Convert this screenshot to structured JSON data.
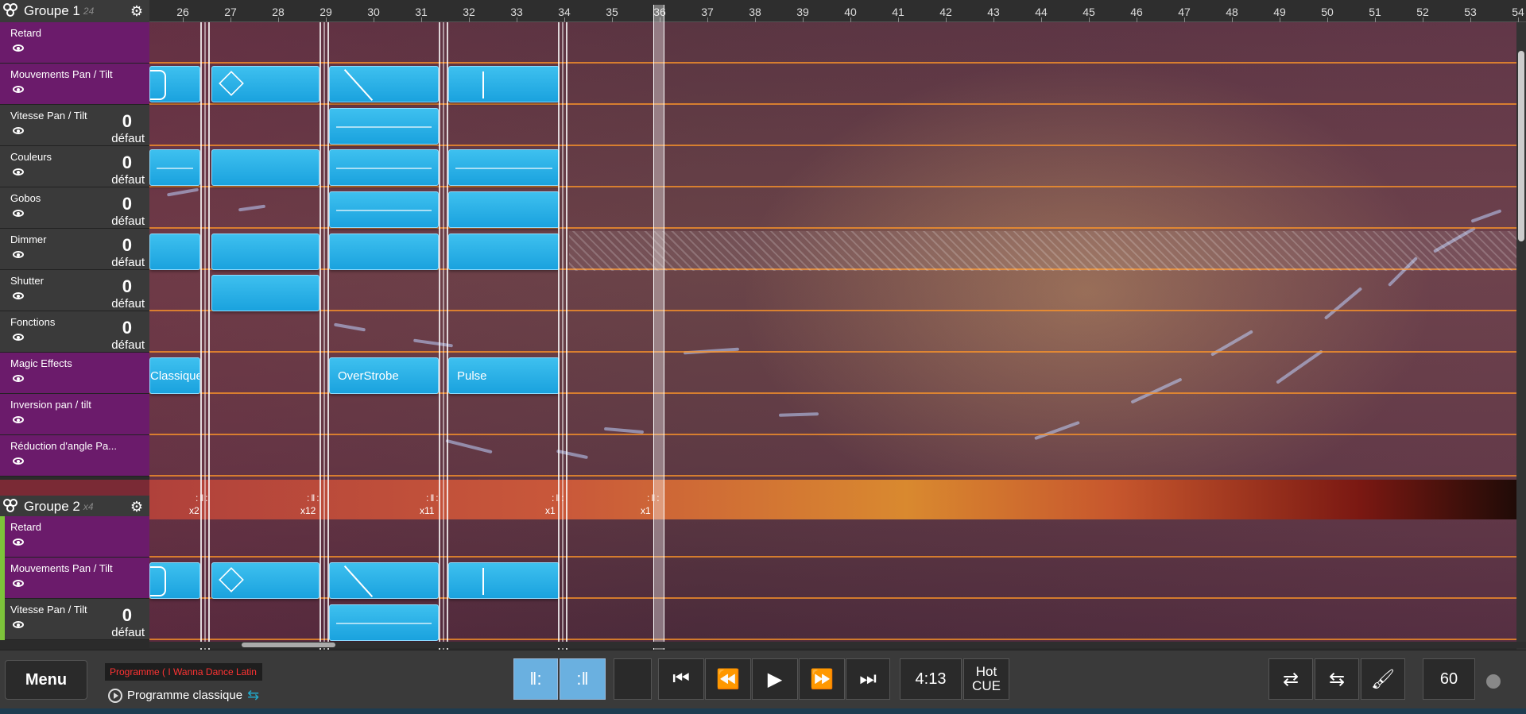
{
  "groups": [
    {
      "name": "Groupe 1",
      "count": "24",
      "tracks": [
        {
          "name": "Retard",
          "value": "",
          "default": "",
          "magic": true
        },
        {
          "name": "Mouvements Pan / Tilt",
          "value": "",
          "default": "",
          "magic": true
        },
        {
          "name": "Vitesse Pan / Tilt",
          "value": "0",
          "default": "défaut",
          "magic": false
        },
        {
          "name": "Couleurs",
          "value": "0",
          "default": "défaut",
          "magic": false
        },
        {
          "name": "Gobos",
          "value": "0",
          "default": "défaut",
          "magic": false
        },
        {
          "name": "Dimmer",
          "value": "0",
          "default": "défaut",
          "magic": false
        },
        {
          "name": "Shutter",
          "value": "0",
          "default": "défaut",
          "magic": false
        },
        {
          "name": "Fonctions",
          "value": "0",
          "default": "défaut",
          "magic": false
        },
        {
          "name": "Magic Effects",
          "value": "",
          "default": "",
          "magic": true
        },
        {
          "name": "Inversion pan / tilt",
          "value": "",
          "default": "",
          "magic": true
        },
        {
          "name": "Réduction d'angle Pa...",
          "value": "",
          "default": "",
          "magic": true
        }
      ]
    },
    {
      "name": "Groupe 2",
      "count": "x4",
      "tracks": [
        {
          "name": "Retard",
          "value": "",
          "default": "",
          "magic": true
        },
        {
          "name": "Mouvements Pan / Tilt",
          "value": "",
          "default": "",
          "magic": true
        },
        {
          "name": "Vitesse Pan / Tilt",
          "value": "0",
          "default": "défaut",
          "magic": false
        }
      ]
    }
  ],
  "ruler": [
    "26",
    "27",
    "28",
    "29",
    "30",
    "31",
    "32",
    "33",
    "34",
    "35",
    "36",
    "37",
    "38",
    "39",
    "40",
    "41",
    "42",
    "43",
    "44",
    "45",
    "46",
    "47",
    "48",
    "49",
    "50",
    "51",
    "52",
    "53",
    "54"
  ],
  "effects": {
    "classique": "Classique",
    "overstrobe": "OverStrobe",
    "pulse": "Pulse"
  },
  "loop_counts": [
    "x2",
    "x12",
    "x11",
    "x1",
    "x1"
  ],
  "toolbar": {
    "menu": "Menu",
    "program_tag": "Programme ( I Wanna Dance Latin",
    "program": "Programme classique",
    "time": "4:13",
    "hot": "Hot",
    "cue": "CUE",
    "bpm": "60"
  },
  "colors": {
    "block": "#1aa2de",
    "magic": "#6b1b6b",
    "lane_line": "#ff9628",
    "group2_bar": "#7dc43a"
  }
}
